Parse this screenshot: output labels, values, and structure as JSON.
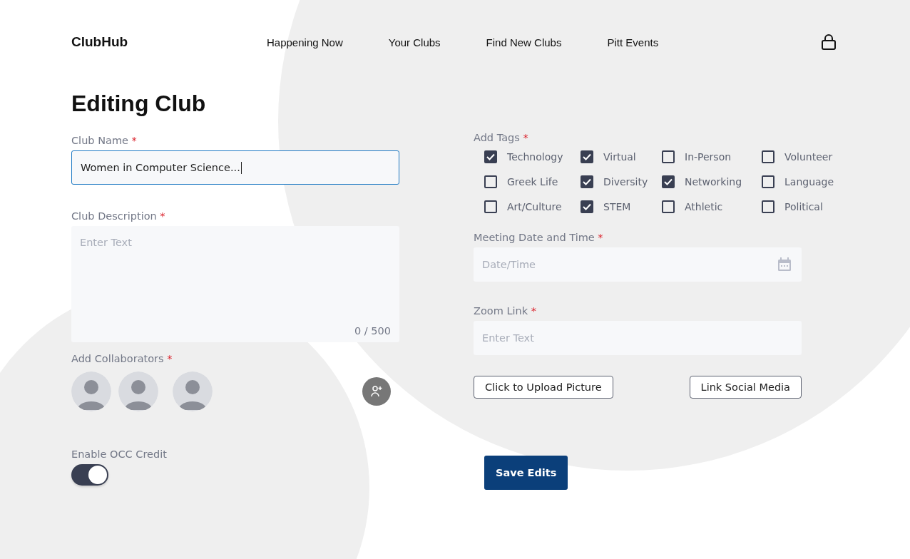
{
  "brand": "ClubHub",
  "nav": [
    {
      "label": "Happening Now"
    },
    {
      "label": "Your Clubs"
    },
    {
      "label": "Find New Clubs"
    },
    {
      "label": "Pitt Events"
    }
  ],
  "title": "Editing Club",
  "club_name": {
    "label": "Club Name",
    "mark": "*",
    "value": "Women in Computer Science...",
    "focused": true
  },
  "description": {
    "label": "Club Description",
    "mark": "*",
    "placeholder": "Enter Text",
    "counter": "0 / 500"
  },
  "collaborators": {
    "label": "Add Collaborators",
    "mark": "*",
    "avatars": [
      {
        "kind": "avatar"
      },
      {
        "kind": "avatar"
      },
      {
        "kind": "avatar"
      }
    ]
  },
  "occ_credit": {
    "label": "Enable OCC Credit",
    "on": true
  },
  "tags": {
    "label": "Add Tags",
    "mark": "*",
    "items": [
      {
        "label": "Technology",
        "checked": true
      },
      {
        "label": "Virtual",
        "checked": true
      },
      {
        "label": "In-Person",
        "checked": false
      },
      {
        "label": "Volunteer",
        "checked": false
      },
      {
        "label": "Greek Life",
        "checked": false
      },
      {
        "label": "Diversity",
        "checked": true
      },
      {
        "label": "Networking",
        "checked": true
      },
      {
        "label": "Language",
        "checked": false
      },
      {
        "label": "Art/Culture",
        "checked": false
      },
      {
        "label": "STEM",
        "checked": true
      },
      {
        "label": "Athletic",
        "checked": false
      },
      {
        "label": "Political",
        "checked": false
      }
    ]
  },
  "meeting": {
    "label": "Meeting Date and Time",
    "mark": "*",
    "placeholder": "Date/Time"
  },
  "zoom": {
    "label": "Zoom Link",
    "mark": "*",
    "placeholder": "Enter Text"
  },
  "upload_button": "Click to Upload Picture",
  "social_button": "Link Social Media",
  "save_button": "Save Edits"
}
